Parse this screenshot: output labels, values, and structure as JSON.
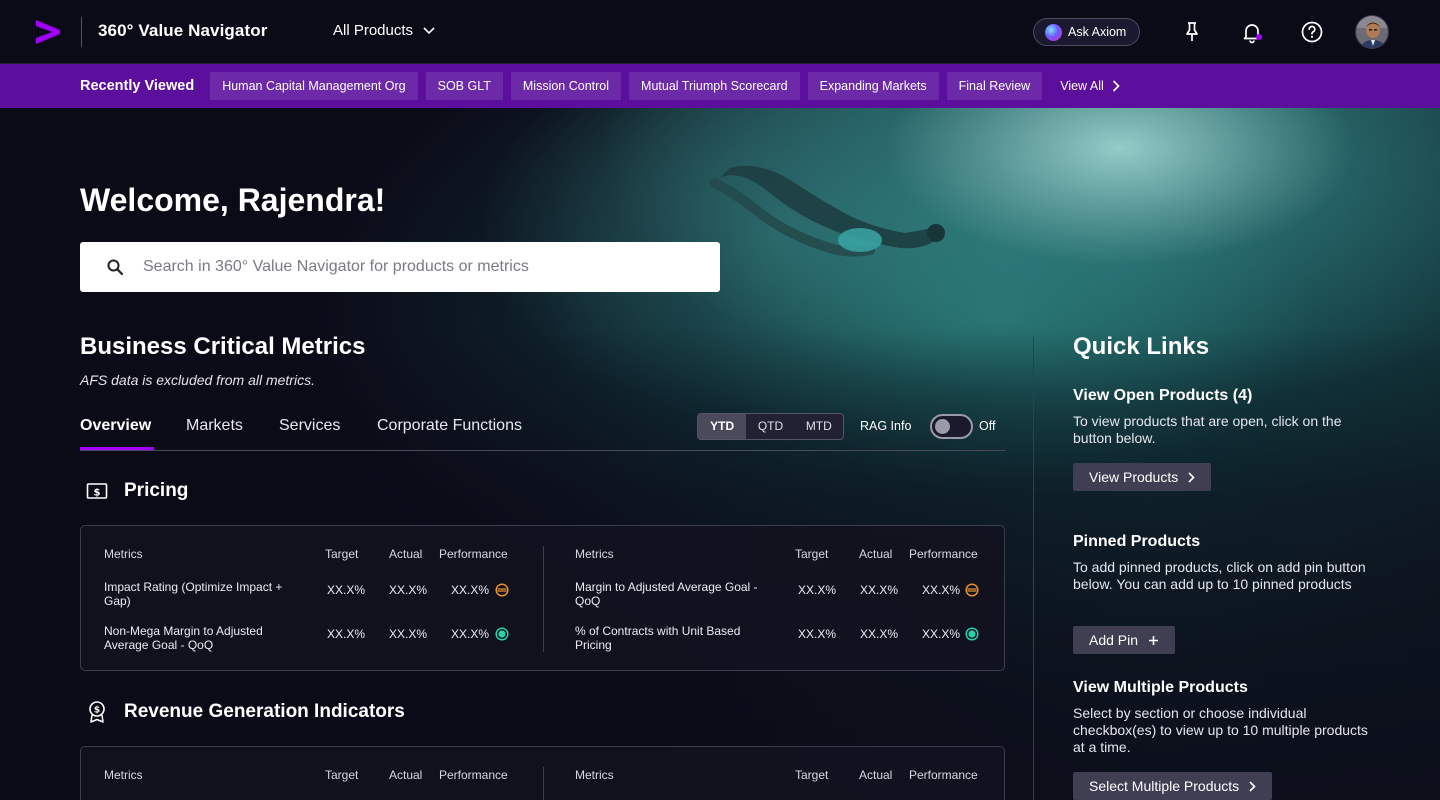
{
  "header": {
    "app_title": "360° Value Navigator",
    "product_select": "All Products",
    "ask_axiom": "Ask Axiom"
  },
  "recent": {
    "label": "Recently Viewed",
    "items": [
      "Human Capital Management Org",
      "SOB GLT",
      "Mission Control",
      "Mutual Triumph Scorecard",
      "Expanding Markets",
      "Final Review"
    ],
    "view_all": "View All"
  },
  "hero": {
    "welcome": "Welcome, Rajendra!",
    "search_placeholder": "Search in 360° Value Navigator for products or metrics"
  },
  "bcm": {
    "title": "Business Critical Metrics",
    "subtitle": "AFS data is excluded from all metrics.",
    "tabs": [
      "Overview",
      "Markets",
      "Services",
      "Corporate Functions"
    ],
    "periods": [
      "YTD",
      "QTD",
      "MTD"
    ],
    "selected_period": "YTD",
    "rag_label": "RAG Info",
    "rag_state": "Off"
  },
  "table_headers": {
    "metrics": "Metrics",
    "target": "Target",
    "actual": "Actual",
    "performance": "Performance"
  },
  "pricing": {
    "title": "Pricing",
    "left": [
      {
        "name": "Impact Rating (Optimize Impact + Gap)",
        "target": "XX.X%",
        "actual": "XX.X%",
        "performance": "XX.X%",
        "status": "neutral"
      },
      {
        "name": "Non-Mega Margin to Adjusted Average Goal  - QoQ",
        "target": "XX.X%",
        "actual": "XX.X%",
        "performance": "XX.X%",
        "status": "positive"
      }
    ],
    "right": [
      {
        "name": "Margin to Adjusted Average Goal  - QoQ",
        "target": "XX.X%",
        "actual": "XX.X%",
        "performance": "XX.X%",
        "status": "neutral"
      },
      {
        "name": "% of Contracts with Unit Based Pricing",
        "target": "XX.X%",
        "actual": "XX.X%",
        "performance": "XX.X%",
        "status": "positive"
      }
    ]
  },
  "revenue": {
    "title": "Revenue Generation Indicators"
  },
  "quick_links": {
    "title": "Quick Links",
    "open_products": {
      "heading": "View Open Products (4)",
      "text": "To view products that are open, click on the button below.",
      "button": "View Products"
    },
    "pinned": {
      "heading": "Pinned Products",
      "text": "To add pinned products, click on add pin button below. You can add up to 10 pinned products",
      "button": "Add Pin"
    },
    "multiple": {
      "heading": "View Multiple Products",
      "text": "Select by section or choose individual checkbox(es) to view up to 10 multiple products at a time.",
      "button": "Select Multiple Products"
    }
  },
  "colors": {
    "brand_purple": "#a100ff",
    "recent_bar": "#5b0f9c",
    "neutral_status": "#e8902c",
    "positive_status": "#2ad1a8",
    "notification_dot": "#a100ff"
  },
  "icons": [
    "accenture-logo-icon",
    "chevron-down-icon",
    "axiom-orb-icon",
    "pin-icon",
    "bell-icon",
    "help-icon",
    "search-icon",
    "dollar-icon",
    "revenue-icon",
    "chevron-right-icon",
    "plus-icon"
  ]
}
